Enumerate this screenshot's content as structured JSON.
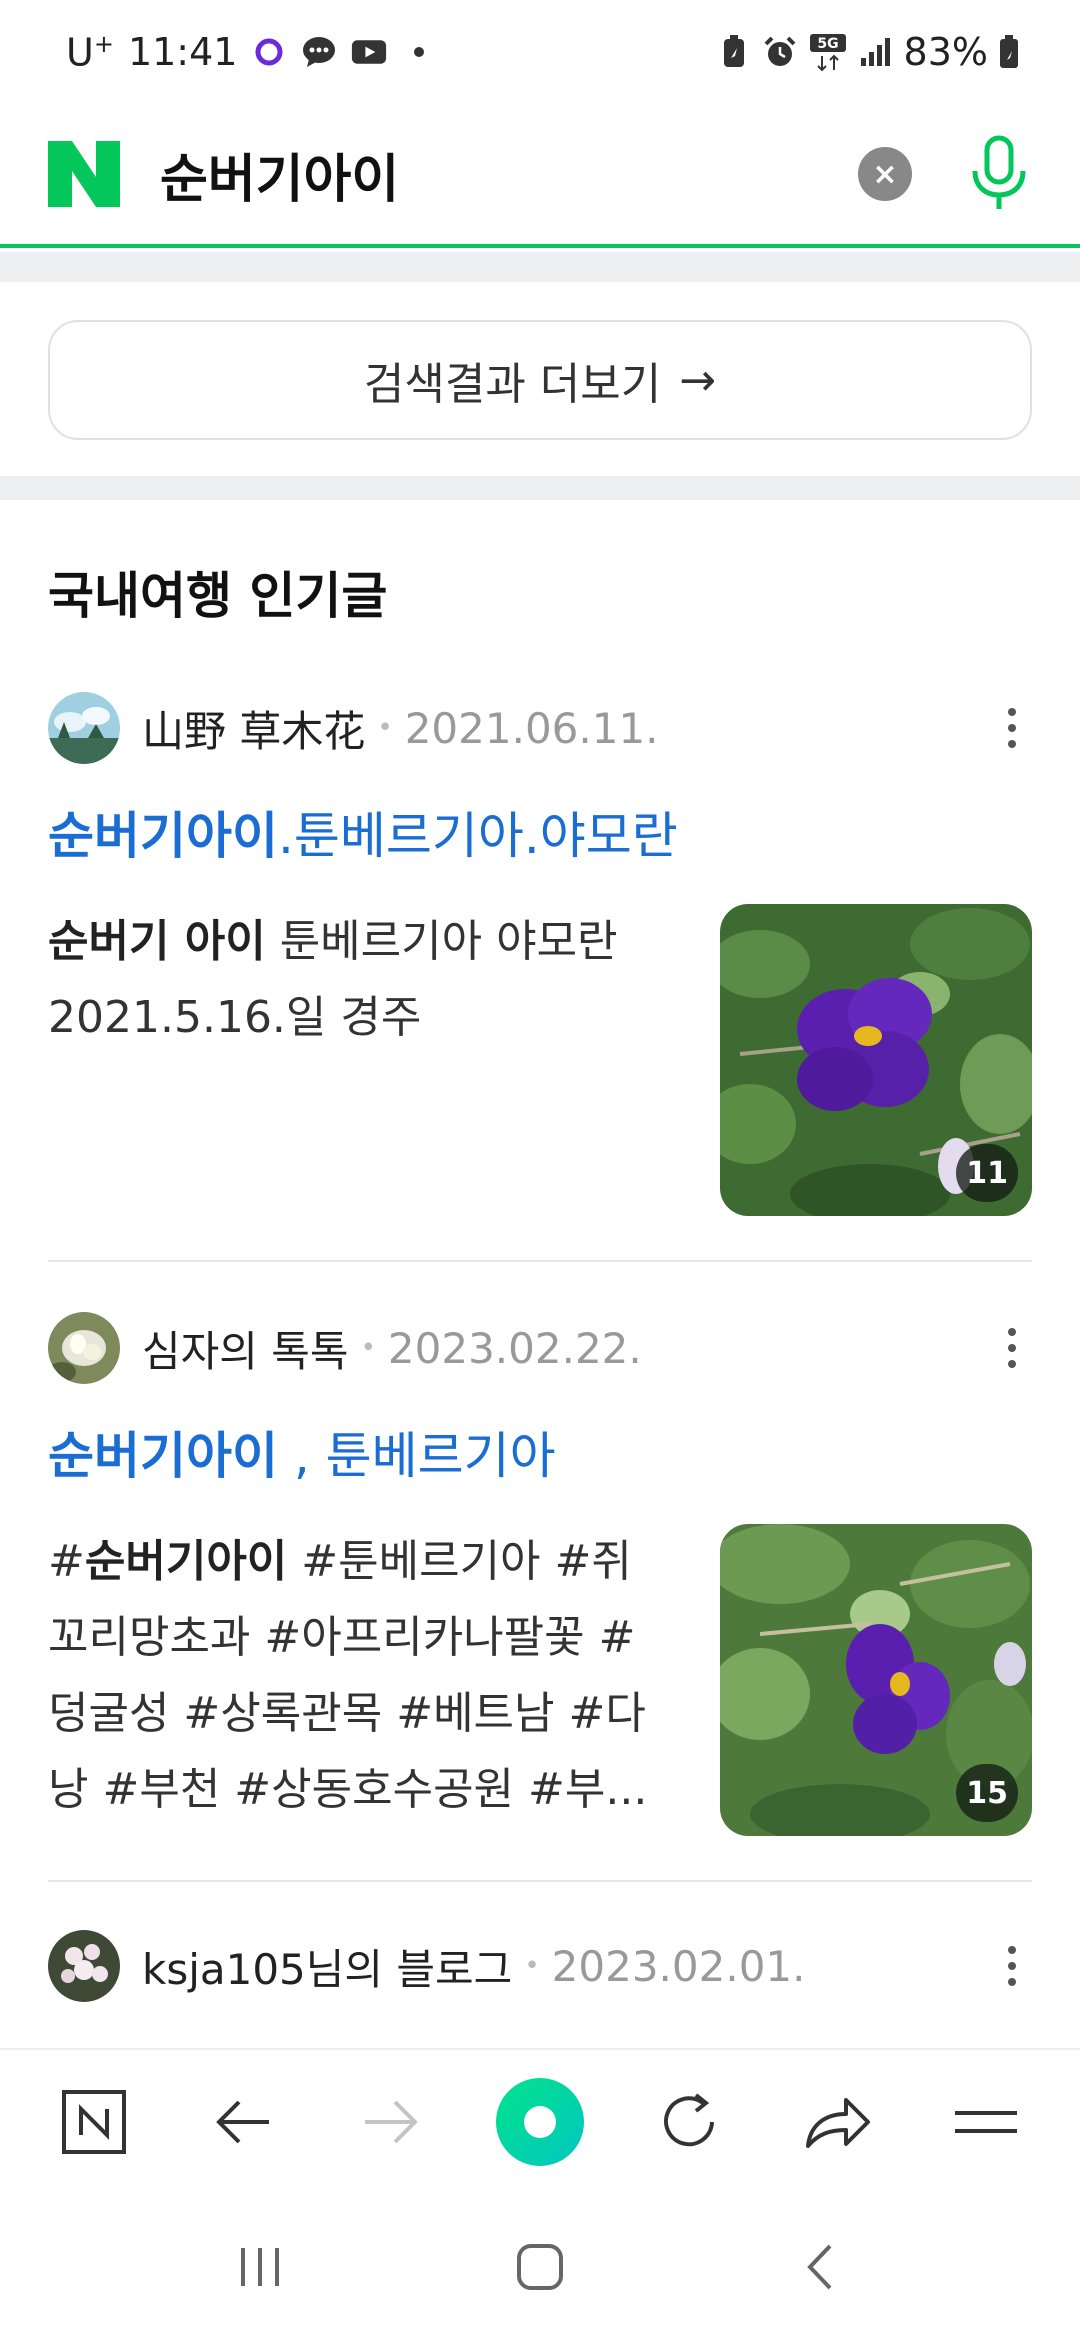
{
  "status_bar": {
    "carrier": "U",
    "carrier_sup": "+",
    "time": "11:41",
    "network": "5G",
    "battery": "83%",
    "icons": [
      "circle-app-icon",
      "chat-icon",
      "youtube-icon",
      "dot-icon",
      "battery-saver-icon",
      "alarm-icon",
      "signal-icon",
      "battery-icon"
    ]
  },
  "search": {
    "logo": "N",
    "query": "순버기아이",
    "clear_label": "×"
  },
  "more_results": {
    "label": "검색결과 더보기",
    "arrow": "→"
  },
  "section": {
    "title": "국내여행 인기글"
  },
  "posts": [
    {
      "author": "山野 草木花",
      "date": "2021.06.11.",
      "title_bold": "순버기아이",
      "title_rest": ".툰베르기아.야모란",
      "body_bold": "순버기 아이",
      "body_rest": " 툰베르기아 야모란 2021.5.16.일 경주",
      "image_count": "11"
    },
    {
      "author": "심자의 톡톡",
      "date": "2023.02.22.",
      "title_bold": "순버기아이",
      "title_rest": " , 툰베르기아",
      "body_prefix": "#",
      "body_bold": "순버기아이",
      "body_rest": " #툰베르기아 #쥐꼬리망초과 #아프리카나팔꽃 #덩굴성 #상록관목 #베트남 #다낭 #부천 #상동호수공원 #부...",
      "image_count": "15"
    },
    {
      "author": "ksja105님의 블로그",
      "date": "2023.02.01."
    }
  ],
  "colors": {
    "brand_green": "#03c75a",
    "link_blue": "#1a6dd3",
    "flower_purple": "#5b1fb0"
  }
}
